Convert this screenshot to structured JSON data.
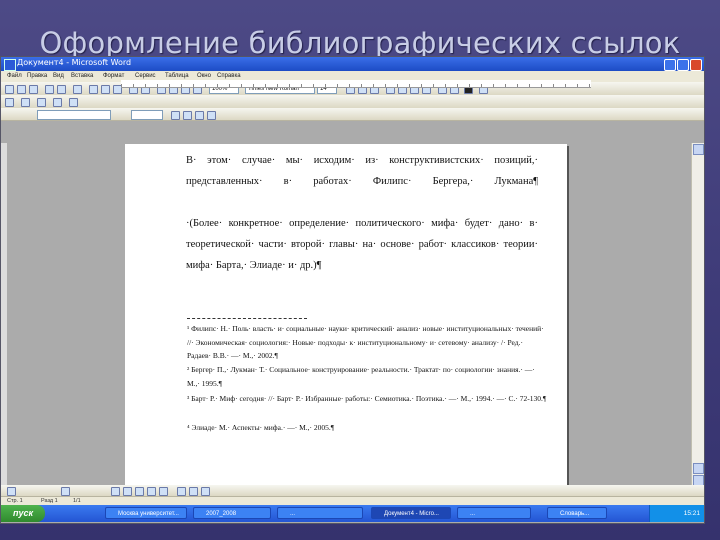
{
  "slide": {
    "title": "Оформление библиографических ссылок"
  },
  "window": {
    "title": "Документ4 - Microsoft Word"
  },
  "menu": [
    "Файл",
    "Правка",
    "Вид",
    "Вставка",
    "Формат",
    "Сервис",
    "Таблица",
    "Окно",
    "Справка"
  ],
  "toolbar": {
    "zoom": "100%",
    "font_name": "Times New Roman",
    "font_size": "14"
  },
  "document": {
    "paragraphs": [
      "В· этом· случае· мы· исходим· из· конструктивистских· позиций,· представленных· в· работах· Филипс· Бергера,· Лукмана¶",
      "·(Более· конкретное· определение· политического· мифа· будет· дано· в· теоретической· части· второй· главы· на· основе· работ· классиков· теории· мифа· Барта,· Элиаде· и· др.)¶"
    ],
    "footnotes": [
      "¹ Филипс· Н.· Поль· власть· и· социальные· науки· критический· анализ· новые· институциональных· течений· //· Экономическая· социология:· Новые· подходы· к· институциональному· и· сетевому· анализу· /· Ред.· Радаев· В.В.· —· М.,· 2002.¶",
      "² Бергер· П.,· Лукман· Т.· Социальное· конструирование· реальности.· Трактат· по· социологии· знания.· —· М.,· 1995.¶",
      "³ Барт· Р.· Миф· сегодня· //· Барт· Р.· Избранные· работы:· Семиотика.· Поэтика.· —· М.,· 1994.· —· С.· 72-130.¶",
      "⁴ Элиаде· М.· Аспекты· мифа.· —· М.,· 2005.¶"
    ]
  },
  "status": {
    "page": "Стр. 1",
    "section": "Разд 1",
    "pages": "1/1"
  },
  "taskbar": {
    "start": "пуск",
    "tasks": [
      "Москва университет...",
      "2007_2008",
      "...",
      "Документ4 - Micro...",
      "...",
      "Словарь..."
    ],
    "clock": "15:21"
  }
}
